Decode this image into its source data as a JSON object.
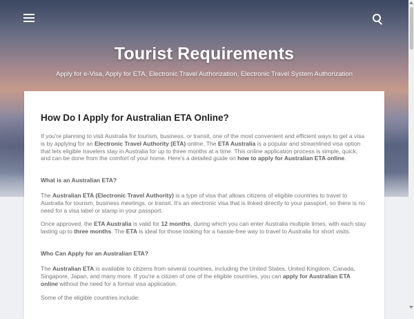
{
  "header": {
    "title": "Tourist Requirements",
    "description": "Apply for e-Visa, Apply for ETA, Electronic Travel Authorization, Electronic Travel System Authorization"
  },
  "post": {
    "title": "How Do I Apply for Australian ETA Online?",
    "intro": {
      "t1": "If you're planning to visit Australia for tourism, business, or transit, one of the most convenient and efficient ways to get a visa is by applying for an ",
      "b1": "Electronic Travel Authority (ETA)",
      "t2": " online. The ",
      "b2": "ETA Australia",
      "t3": " is a popular and streamlined visa option that lets eligible travelers stay in Australia for up to three months at a time. This online application process is simple, quick, and can be done from the comfort of your home. Here's a detailed guide on ",
      "b3": "how to apply for Australian ETA online",
      "t4": "."
    },
    "heading1": "What is an Australian ETA?",
    "p1": {
      "t1": "The ",
      "b1": "Australian ETA (Electronic Travel Authority)",
      "t2": " is a type of visa that allows citizens of eligible countries to travel to Australia for tourism, business meetings, or transit. It's an electronic visa that is linked directly to your passport, so there is no need for a visa label or stamp in your passport."
    },
    "p2": {
      "t1": "Once approved, the ",
      "b1": "ETA Australia",
      "t2": " is valid for ",
      "b2": "12 months",
      "t3": ", during which you can enter Australia multiple times, with each stay lasting up to ",
      "b3": "three months",
      "t4": ". The ",
      "b4": "ETA",
      "t5": " is ideal for those looking for a hassle-free way to travel to Australia for short visits."
    },
    "heading2": "Who Can Apply for an Australian ETA?",
    "p3": {
      "t1": "The ",
      "b1": "Australian ETA",
      "t2": " is available to citizens from several countries, including the United States, United Kingdom, Canada, Singapore, Japan, and many more. If you're a citizen of one of the eligible countries, you can ",
      "b2": "apply for Australian ETA online",
      "t3": " without the need for a formal visa application."
    },
    "p4": "Some of the eligible countries include:"
  },
  "icons": {
    "menu": "hamburger-menu-icon",
    "search": "search-icon"
  },
  "colors": {
    "title_text": "#212121",
    "body_text": "#757575",
    "page_background": "#eef0f4"
  }
}
